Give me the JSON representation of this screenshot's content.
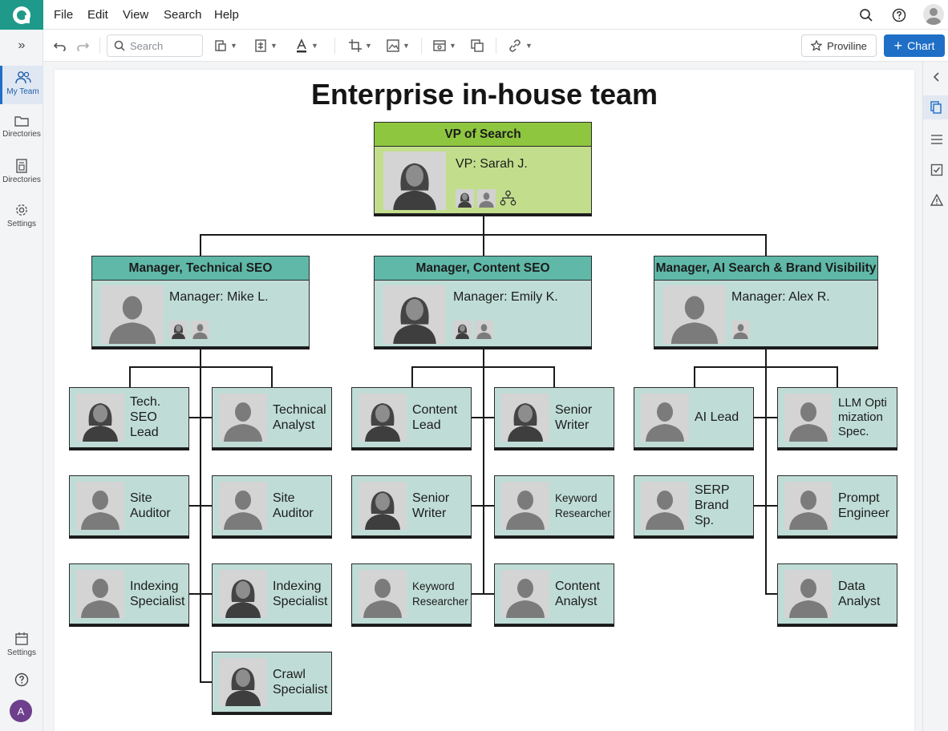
{
  "menubar": {
    "items": [
      "File",
      "Edit",
      "View",
      "Search",
      "Help"
    ],
    "right_icons": [
      "search-icon",
      "help-icon",
      "user-avatar-icon"
    ]
  },
  "toolbar": {
    "search_placeholder": "Search",
    "proviline_label": "Proviline",
    "chart_label": "Chart",
    "chart_button_color": "#1f6fc6"
  },
  "sidebar": {
    "items": [
      {
        "label": "My Team",
        "icon": "team-icon",
        "active": true
      },
      {
        "label": "Directories",
        "icon": "folder-icon"
      },
      {
        "label": "Directories",
        "icon": "document-icon"
      },
      {
        "label": "Settings",
        "icon": "gear-icon"
      }
    ],
    "bottom": [
      {
        "label": "Settings",
        "icon": "calendar-icon"
      }
    ],
    "avatar_letter": "A"
  },
  "chart": {
    "title": "Enterprise in-house team",
    "vp": {
      "role": "VP of Search",
      "name": "VP: Sarah J."
    },
    "managers": [
      {
        "role": "Manager, Technical SEO",
        "name": "Manager: Mike L."
      },
      {
        "role": "Manager, Content SEO",
        "name": "Manager: Emily K."
      },
      {
        "role": "Manager, AI Search & Brand Visibility",
        "name": "Manager: Alex R."
      }
    ],
    "teams": {
      "technical": [
        "Tech. SEO Lead",
        "Technical Analyst",
        "Site Auditor",
        "Site Auditor",
        "Indexing Specialist",
        "Indexing Specialist",
        "Crawl Specialist"
      ],
      "content": [
        "Content Lead",
        "Senior Writer",
        "Senior Writer",
        "Keyword Researcher",
        "Keyword Researcher",
        "Content Analyst"
      ],
      "ai": [
        "AI Lead",
        "LLM Optimization Spec.",
        "SERP Brand Sp.",
        "Prompt Engineer",
        "Data Analyst"
      ]
    },
    "colors": {
      "vp_header": "#8ec63f",
      "vp_body": "#c2de8c",
      "manager_header": "#5fb8a8",
      "box_body": "#bfddd6"
    }
  }
}
